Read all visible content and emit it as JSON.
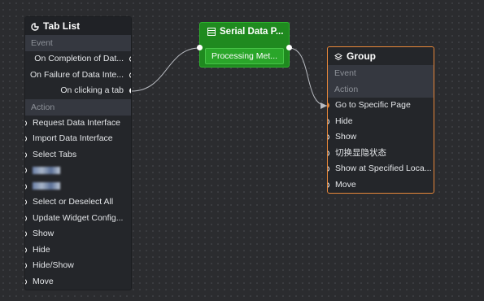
{
  "tab_list": {
    "title": "Tab List",
    "event_label": "Event",
    "events": [
      "On Completion of Dat...",
      "On Failure of Data Inte...",
      "On clicking a tab"
    ],
    "action_label": "Action",
    "actions": [
      "Request Data Interface",
      "Import Data Interface",
      "Select Tabs",
      "",
      "",
      "Select or Deselect All",
      "Update Widget Config...",
      "Show",
      "Hide",
      "Hide/Show",
      "Move"
    ]
  },
  "serial": {
    "title": "Serial Data P...",
    "method": "Processing Met..."
  },
  "group": {
    "title": "Group",
    "event_label": "Event",
    "action_label": "Action",
    "actions": [
      "Go to Specific Page",
      "Hide",
      "Show",
      "切换显隐状态",
      "Show at Specified Loca...",
      "Move"
    ]
  },
  "colors": {
    "canvas": "#2b2c2f",
    "node_bg": "#24262a",
    "serial_green": "#1f8a1f",
    "group_border": "#e8883a"
  },
  "icons": {
    "tab_list": "tab-list-icon",
    "serial": "serial-data-icon",
    "group": "layers-icon"
  }
}
